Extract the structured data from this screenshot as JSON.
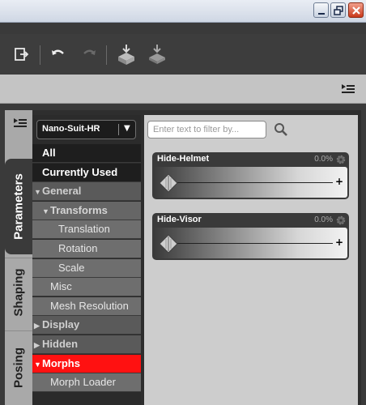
{
  "window": {
    "minimize_label": "",
    "maximize_label": "",
    "close_label": ""
  },
  "toolbar": {
    "icons": [
      "export-icon",
      "undo-icon",
      "redo-icon",
      "load-figure-icon",
      "load-pose-icon"
    ]
  },
  "tabs": {
    "parameters": "Parameters",
    "shaping": "Shaping",
    "posing": "Posing"
  },
  "node_select": {
    "value": "Nano-Suit-HR"
  },
  "tree": [
    {
      "label": "All",
      "style": "dark",
      "arrow": ""
    },
    {
      "label": "Currently Used",
      "style": "dark",
      "arrow": ""
    },
    {
      "label": "General",
      "style": "group",
      "arrow": "▼"
    },
    {
      "label": "Transforms",
      "style": "sub",
      "arrow": "▼"
    },
    {
      "label": "Translation",
      "style": "leaf",
      "arrow": ""
    },
    {
      "label": "Rotation",
      "style": "leaf",
      "arrow": ""
    },
    {
      "label": "Scale",
      "style": "leaf",
      "arrow": ""
    },
    {
      "label": "Misc",
      "style": "leaf",
      "arrow": ""
    },
    {
      "label": "Mesh Resolution",
      "style": "leaf",
      "arrow": ""
    },
    {
      "label": "Display",
      "style": "group",
      "arrow": "▶"
    },
    {
      "label": "Hidden",
      "style": "group",
      "arrow": "▶"
    },
    {
      "label": "Morphs",
      "style": "sel",
      "arrow": "▼"
    },
    {
      "label": "Morph Loader",
      "style": "leaf",
      "arrow": ""
    }
  ],
  "filter": {
    "placeholder": "Enter text to filter by..."
  },
  "sliders": [
    {
      "name": "Hide-Helmet",
      "value": "0.0%",
      "fraction": 0.0
    },
    {
      "name": "Hide-Visor",
      "value": "0.0%",
      "fraction": 0.0
    }
  ],
  "colors": {
    "selected": "#ff1111",
    "panel": "#3a3a3a"
  }
}
